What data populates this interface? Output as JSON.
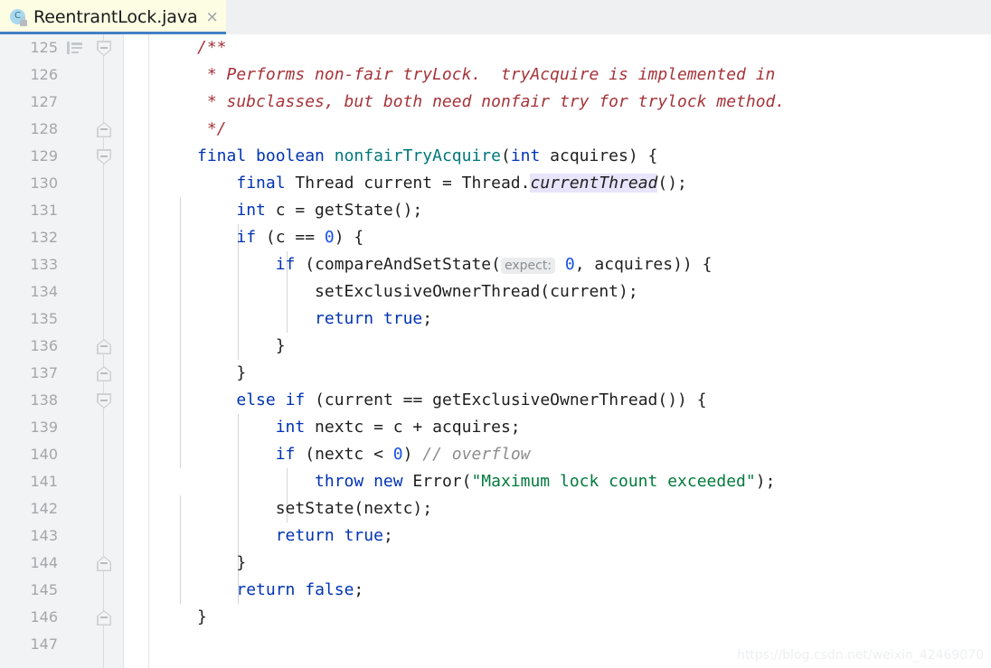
{
  "tab": {
    "title": "ReentrantLock.java",
    "icon": "java-class-icon",
    "lock_badge": "lock-icon",
    "close_label": "×"
  },
  "gutter": {
    "first_line": 125,
    "last_line": 147,
    "format_marker_line": 125,
    "line_numbers": [
      "125",
      "126",
      "127",
      "128",
      "129",
      "130",
      "131",
      "132",
      "133",
      "134",
      "135",
      "136",
      "137",
      "138",
      "139",
      "140",
      "141",
      "142",
      "143",
      "144",
      "145",
      "146",
      "147"
    ],
    "fold_markers": [
      {
        "line": 125,
        "type": "down"
      },
      {
        "line": 128,
        "type": "up"
      },
      {
        "line": 129,
        "type": "down"
      },
      {
        "line": 136,
        "type": "up"
      },
      {
        "line": 137,
        "type": "up"
      },
      {
        "line": 138,
        "type": "down"
      },
      {
        "line": 144,
        "type": "up"
      },
      {
        "line": 146,
        "type": "up"
      }
    ]
  },
  "code": {
    "language": "java",
    "lines": [
      {
        "n": "125",
        "text": "/**"
      },
      {
        "n": "126",
        "text": " * Performs non-fair tryLock.  tryAcquire is implemented in"
      },
      {
        "n": "127",
        "text": " * subclasses, but both need nonfair try for trylock method."
      },
      {
        "n": "128",
        "text": " */"
      },
      {
        "n": "129",
        "text": "final boolean nonfairTryAcquire(int acquires) {"
      },
      {
        "n": "130",
        "text": "    final Thread current = Thread.currentThread();"
      },
      {
        "n": "131",
        "text": "    int c = getState();"
      },
      {
        "n": "132",
        "text": "    if (c == 0) {"
      },
      {
        "n": "133",
        "text": "        if (compareAndSetState( expect: 0, acquires)) {"
      },
      {
        "n": "134",
        "text": "            setExclusiveOwnerThread(current);"
      },
      {
        "n": "135",
        "text": "            return true;"
      },
      {
        "n": "136",
        "text": "        }"
      },
      {
        "n": "137",
        "text": "    }"
      },
      {
        "n": "138",
        "text": "    else if (current == getExclusiveOwnerThread()) {"
      },
      {
        "n": "139",
        "text": "        int nextc = c + acquires;"
      },
      {
        "n": "140",
        "text": "        if (nextc < 0) // overflow"
      },
      {
        "n": "141",
        "text": "            throw new Error(\"Maximum lock count exceeded\");"
      },
      {
        "n": "142",
        "text": "        setState(nextc);"
      },
      {
        "n": "143",
        "text": "        return true;"
      },
      {
        "n": "144",
        "text": "    }"
      },
      {
        "n": "145",
        "text": "    return false;"
      },
      {
        "n": "146",
        "text": "}"
      },
      {
        "n": "147",
        "text": ""
      }
    ],
    "parameter_hint": "expect:",
    "string_literal": "\"Maximum lock count exceeded\"",
    "inline_comment": "// overflow",
    "colors": {
      "keyword": "#0033b3",
      "method": "#00777b",
      "string": "#027a3e",
      "number": "#1750eb",
      "comment": "#8c8c8c",
      "javadoc": "#a5343a",
      "static_highlight": "#e8e4fb",
      "editor_background": "#ffffff",
      "gutter_background": "#f2f3f4",
      "tab_active_background": "#fdfde4",
      "tab_accent": "#4281c4"
    }
  },
  "watermark": {
    "text": "https://blog.csdn.net/weixin_42469070"
  }
}
